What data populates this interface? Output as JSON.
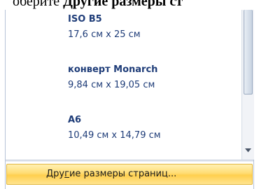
{
  "heading": {
    "prefix": "оберите ",
    "bold": "Другие размеры ст"
  },
  "size_list": {
    "items": [
      {
        "name": "ISO B5",
        "dims": "17,6 см x 25 см"
      },
      {
        "name": "конверт Monarch",
        "dims": "9,84 см x 19,05 см"
      },
      {
        "name": "A6",
        "dims": "10,49 см x 14,79 см"
      }
    ]
  },
  "scrollbar": {
    "down_icon": "triangle-down-icon"
  },
  "more_sizes": {
    "accelerator": "г",
    "label_before": "Дру",
    "label_after": "ие размеры страниц..."
  },
  "colors": {
    "item_text": "#1e3c78",
    "highlight": "#ffd966"
  }
}
